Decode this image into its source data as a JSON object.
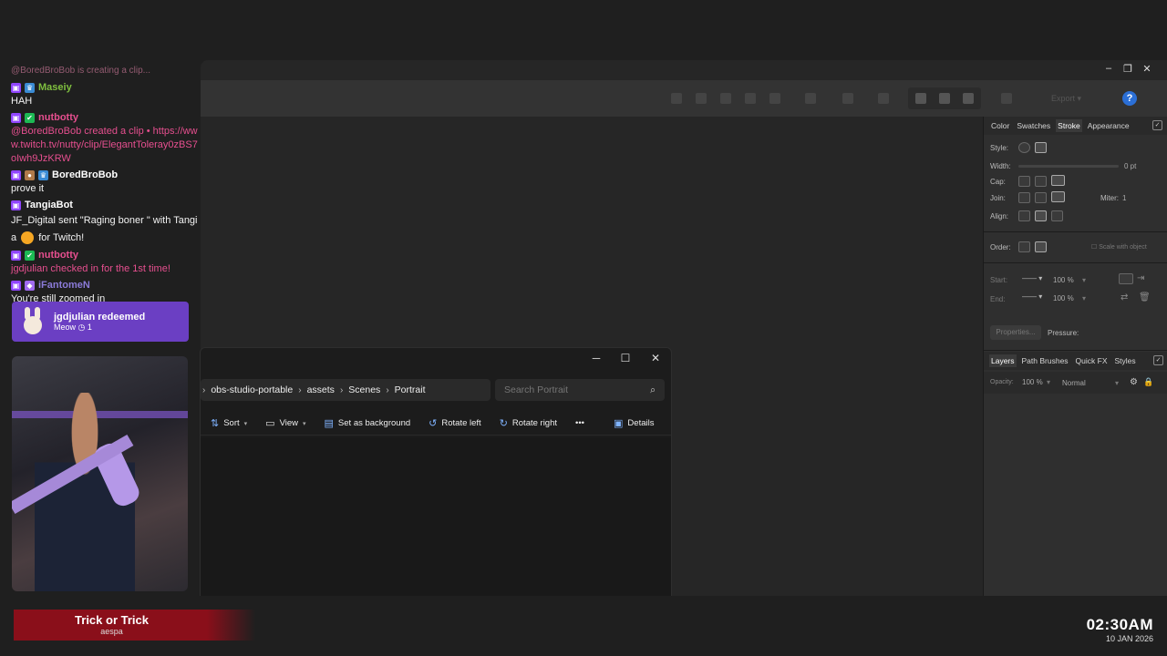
{
  "chat": {
    "faded_line": "@BoredBroBob is creating a clip...",
    "messages": [
      {
        "user": "Maseiy",
        "color": "#7fbf3f",
        "badges": [
          "twitch",
          "blue"
        ],
        "text": "HAH",
        "pink": false
      },
      {
        "user": "nutbotty",
        "color": "#e64f8f",
        "badges": [
          "twitch",
          "green"
        ],
        "text": "@BoredBroBob created a clip • https://www.twitch.tv/nutty/clip/ElegantToleray0zBS7oIwh9JzKRW",
        "pink": true
      },
      {
        "user": "BoredBroBob",
        "color": "#ffffff",
        "badges": [
          "twitch",
          "brown",
          "blue"
        ],
        "text": "prove it",
        "pink": false
      },
      {
        "user": "TangiaBot",
        "color": "#ffffff",
        "badges": [
          "twitch"
        ],
        "text": "JF_Digital sent \"Raging boner \" with Tangia",
        "suffix": "for Twitch!",
        "pink": false
      },
      {
        "user": "nutbotty",
        "color": "#e64f8f",
        "badges": [
          "twitch",
          "green"
        ],
        "text": "jgdjulian checked in for the 1st time!",
        "pink": true
      },
      {
        "user": "iFantomeN",
        "color": "#8b7bd8",
        "badges": [
          "twitch",
          "purple"
        ],
        "text": "You're still zoomed in",
        "pink": false
      }
    ]
  },
  "redeem": {
    "title": "jgdjulian redeemed",
    "reward": "Meow",
    "count": "1"
  },
  "now_playing": {
    "title": "Trick or Trick",
    "artist": "aespa"
  },
  "clock": {
    "time": "02:30AM",
    "date": "10 JAN 2026"
  },
  "app": {
    "export_label": "Export",
    "panel_tabs": [
      "Color",
      "Swatches",
      "Stroke",
      "Appearance"
    ],
    "active_tab": "Stroke",
    "stroke": {
      "style_label": "Style:",
      "width_label": "Width:",
      "width_value": "0 pt",
      "cap_label": "Cap:",
      "join_label": "Join:",
      "miter_label": "Miter:",
      "miter_value": "1",
      "align_label": "Align:",
      "order_label": "Order:",
      "scale_label": "Scale with object",
      "start_label": "Start:",
      "start_value": "100 %",
      "end_label": "End:",
      "end_value": "100 %",
      "properties_label": "Properties...",
      "pressure_label": "Pressure:"
    },
    "layer_tabs": [
      "Layers",
      "Path Brushes",
      "Quick FX",
      "Styles"
    ],
    "layers": {
      "opacity_label": "Opacity:",
      "opacity_value": "100 %",
      "blend_mode": "Normal"
    }
  },
  "explorer": {
    "breadcrumb": [
      "obs-studio-portable",
      "assets",
      "Scenes",
      "Portrait"
    ],
    "search_placeholder": "Search Portrait",
    "commands": [
      {
        "icon": "sort-icon",
        "label": "Sort",
        "caret": true
      },
      {
        "icon": "view-icon",
        "label": "View",
        "caret": true
      },
      {
        "icon": "background-icon",
        "label": "Set as background",
        "caret": false
      },
      {
        "icon": "rotate-left-icon",
        "label": "Rotate left",
        "caret": false
      },
      {
        "icon": "rotate-right-icon",
        "label": "Rotate right",
        "caret": false
      }
    ],
    "more_label": "•••",
    "details_label": "Details"
  }
}
